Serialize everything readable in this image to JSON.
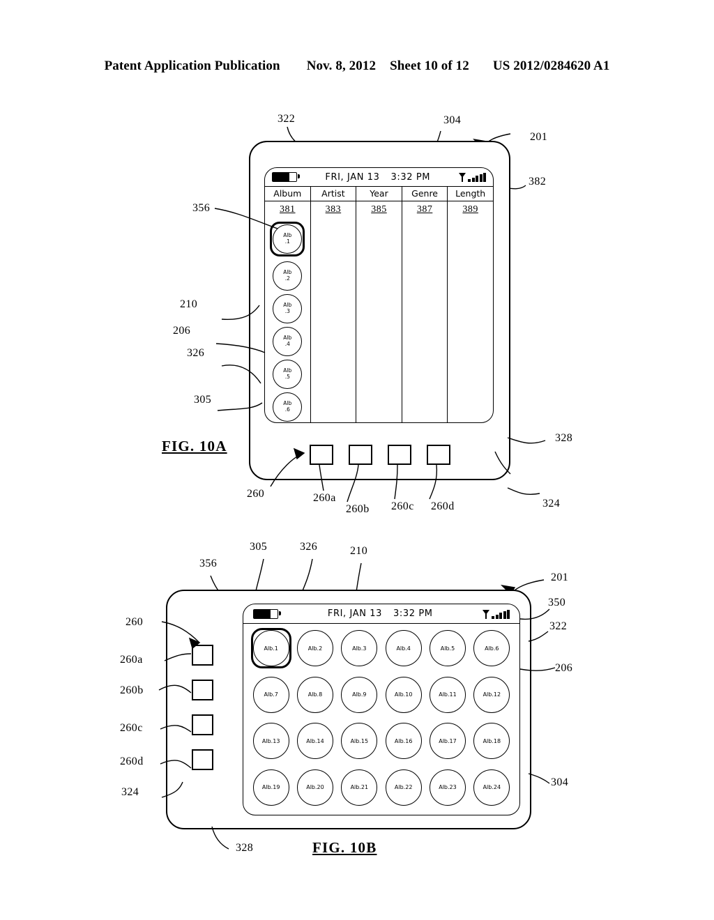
{
  "header": {
    "publication": "Patent Application Publication",
    "date": "Nov. 8, 2012",
    "sheet": "Sheet 10 of 12",
    "docnum": "US 2012/0284620 A1"
  },
  "status_bar": {
    "date": "FRI, JAN 13",
    "time": "3:32 PM",
    "battery_icon": "battery-icon",
    "signal_icon": "signal-bars-icon"
  },
  "fig_a": {
    "caption": "FIG. 10A",
    "columns": [
      {
        "header": "Album",
        "ref": "381"
      },
      {
        "header": "Artist",
        "ref": "383"
      },
      {
        "header": "Year",
        "ref": "385"
      },
      {
        "header": "Genre",
        "ref": "387"
      },
      {
        "header": "Length",
        "ref": "389"
      }
    ],
    "albums": [
      {
        "line1": "Alb",
        "line2": ".1",
        "selected": true
      },
      {
        "line1": "Alb",
        "line2": ".2",
        "selected": false
      },
      {
        "line1": "Alb",
        "line2": ".3",
        "selected": false
      },
      {
        "line1": "Alb",
        "line2": ".4",
        "selected": false
      },
      {
        "line1": "Alb",
        "line2": ".5",
        "selected": false
      },
      {
        "line1": "Alb",
        "line2": ".6",
        "selected": false
      }
    ],
    "buttons": [
      "260a",
      "260b",
      "260c",
      "260d"
    ],
    "refs": {
      "r322": "322",
      "r304": "304",
      "r201": "201",
      "r382": "382",
      "r356": "356",
      "r210": "210",
      "r206": "206",
      "r326": "326",
      "r305": "305",
      "r328": "328",
      "r324": "324",
      "r260": "260",
      "r260a": "260a",
      "r260b": "260b",
      "r260c": "260c",
      "r260d": "260d"
    }
  },
  "fig_b": {
    "caption": "FIG. 10B",
    "albums": [
      {
        "label": "Alb.1",
        "selected": true
      },
      {
        "label": "Alb.2",
        "selected": false
      },
      {
        "label": "Alb.3",
        "selected": false
      },
      {
        "label": "Alb.4",
        "selected": false
      },
      {
        "label": "Alb.5",
        "selected": false
      },
      {
        "label": "Alb.6",
        "selected": false
      },
      {
        "label": "Alb.7",
        "selected": false
      },
      {
        "label": "Alb.8",
        "selected": false
      },
      {
        "label": "Alb.9",
        "selected": false
      },
      {
        "label": "Alb.10",
        "selected": false
      },
      {
        "label": "Alb.11",
        "selected": false
      },
      {
        "label": "Alb.12",
        "selected": false
      },
      {
        "label": "Alb.13",
        "selected": false
      },
      {
        "label": "Alb.14",
        "selected": false
      },
      {
        "label": "Alb.15",
        "selected": false
      },
      {
        "label": "Alb.16",
        "selected": false
      },
      {
        "label": "Alb.17",
        "selected": false
      },
      {
        "label": "Alb.18",
        "selected": false
      },
      {
        "label": "Alb.19",
        "selected": false
      },
      {
        "label": "Alb.20",
        "selected": false
      },
      {
        "label": "Alb.21",
        "selected": false
      },
      {
        "label": "Alb.22",
        "selected": false
      },
      {
        "label": "Alb.23",
        "selected": false
      },
      {
        "label": "Alb.24",
        "selected": false
      }
    ],
    "refs": {
      "r356": "356",
      "r305": "305",
      "r326": "326",
      "r210": "210",
      "r201": "201",
      "r350": "350",
      "r322": "322",
      "r206": "206",
      "r304": "304",
      "r260": "260",
      "r260a": "260a",
      "r260b": "260b",
      "r260c": "260c",
      "r260d": "260d",
      "r324": "324",
      "r328": "328"
    }
  }
}
